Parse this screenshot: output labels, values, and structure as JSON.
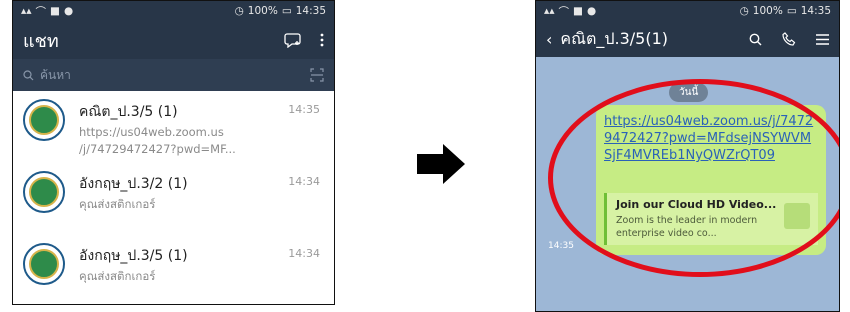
{
  "status": {
    "battery": "100%",
    "time": "14:35"
  },
  "left": {
    "title": "แชท",
    "search_placeholder": "ค้นหา",
    "chats": [
      {
        "name": "คณิต_ป.3/5 (1)",
        "time": "14:35",
        "preview1": "https://us04web.zoom.us",
        "preview2": "/j/74729472427?pwd=MF..."
      },
      {
        "name": "อังกฤษ_ป.3/2 (1)",
        "time": "14:34",
        "preview1": "คุณส่งสติกเกอร์",
        "preview2": ""
      },
      {
        "name": "อังกฤษ_ป.3/5 (1)",
        "time": "14:34",
        "preview1": "คุณส่งสติกเกอร์",
        "preview2": ""
      }
    ]
  },
  "right": {
    "title": "คณิต_ป.3/5(1)",
    "date": "วันนี้",
    "link": "https://us04web.zoom.us/j/74729472427?pwd=MFdsejNSYWVMSjF4MVREb1NyQWZrQT09",
    "preview_title": "Join our Cloud HD Video...",
    "preview_desc": "Zoom is the leader in modern enterprise video co...",
    "msg_time": "14:35"
  },
  "colors": {
    "accent": "#e10e1b",
    "bubble": "#c6ec84",
    "header": "#283648"
  }
}
